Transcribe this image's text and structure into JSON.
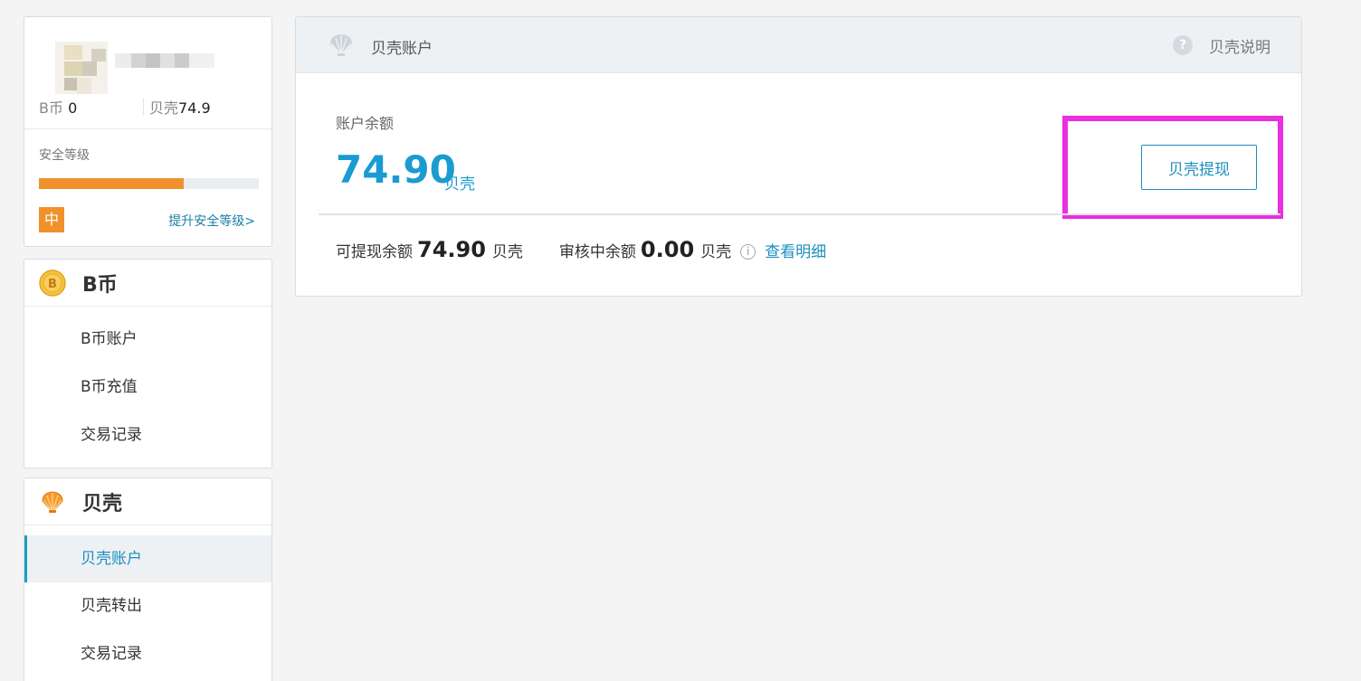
{
  "user": {
    "bcoin_label": "B币",
    "bcoin_value": "0",
    "shell_label": "贝壳",
    "shell_value": "74.9",
    "security_label": "安全等级",
    "security_level": "中",
    "security_fraction": 0.66,
    "security_link": "提升安全等级>"
  },
  "nav": {
    "bcoin": {
      "title": "B币",
      "icon": "bcoin-icon",
      "items": [
        "B币账户",
        "B币充值",
        "交易记录"
      ]
    },
    "shell": {
      "title": "贝壳",
      "icon": "shell-icon",
      "items": [
        "贝壳账户",
        "贝壳转出",
        "交易记录"
      ],
      "active_index": 0
    }
  },
  "main": {
    "title": "贝壳账户",
    "help_label": "贝壳说明",
    "balance_label": "账户余额",
    "balance_value": "74.90",
    "balance_unit": "贝壳",
    "withdraw_label": "贝壳提现",
    "withdrawable_label": "可提现余额",
    "withdrawable_value": "74.90",
    "withdrawable_unit": "贝壳",
    "pending_label": "审核中余额",
    "pending_value": "0.00",
    "pending_unit": "贝壳",
    "detail_link": "查看明细"
  },
  "colors": {
    "accent": "#1d8fbf",
    "amount": "#1a9bd1",
    "security": "#f0912a",
    "highlight": "#ea2ee0"
  }
}
